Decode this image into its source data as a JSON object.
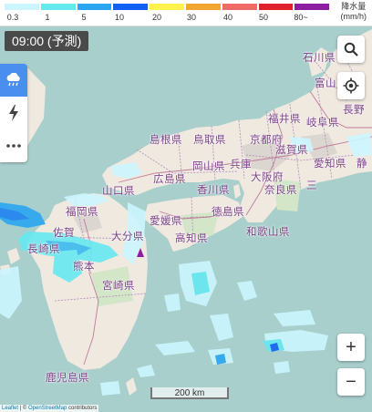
{
  "legend": {
    "colors": [
      "#ccf6ff",
      "#66e8f0",
      "#2aa6f0",
      "#1360f5",
      "#fff24a",
      "#f0a630",
      "#f06a6a",
      "#e0202c",
      "#8c1ea0"
    ],
    "labels": [
      "0.3",
      "1",
      "5",
      "10",
      "20",
      "30",
      "40",
      "50",
      "80~"
    ],
    "unit_title": "降水量",
    "unit": "(mm/h)"
  },
  "time_label": "09:00 (予測)",
  "side_panel": {
    "items": [
      {
        "icon": "rain-cloud-icon",
        "active": true
      },
      {
        "icon": "lightning-icon",
        "active": false
      },
      {
        "icon": "more-dots-icon",
        "active": false
      }
    ]
  },
  "controls": {
    "search_icon": "search-icon",
    "locate_icon": "locate-icon",
    "zoom_in": "+",
    "zoom_out": "−"
  },
  "prefectures": {
    "ishikawa": "石川県",
    "toyama": "富山",
    "fukui": "福井県",
    "gifu": "岐阜県",
    "nagano": "長野",
    "shimane": "島根県",
    "tottori": "鳥取県",
    "kyoto": "京都府",
    "shiga": "滋賀県",
    "aichi": "愛知県",
    "shizuoka": "静",
    "okayama": "岡山県",
    "hyogo": "兵庫",
    "osaka": "大阪府",
    "hiroshima": "広島県",
    "kagawa": "香川県",
    "nara": "奈良県",
    "mie": "三",
    "yamaguchi": "山口県",
    "fukuoka": "福岡県",
    "ehime": "愛媛県",
    "tokushima": "徳島県",
    "wakayama": "和歌山県",
    "saga": "佐賀",
    "oita": "大分県",
    "kochi": "高知県",
    "nagasaki": "長崎県",
    "kumamoto": "熊本",
    "miyazaki": "宮崎県",
    "kagoshima": "鹿児島県"
  },
  "scale_label": "200 km",
  "attribution": {
    "leaflet": "Leaflet",
    "separator": " | © ",
    "osm": "OpenStreetMap",
    "contributors": " contributors"
  }
}
